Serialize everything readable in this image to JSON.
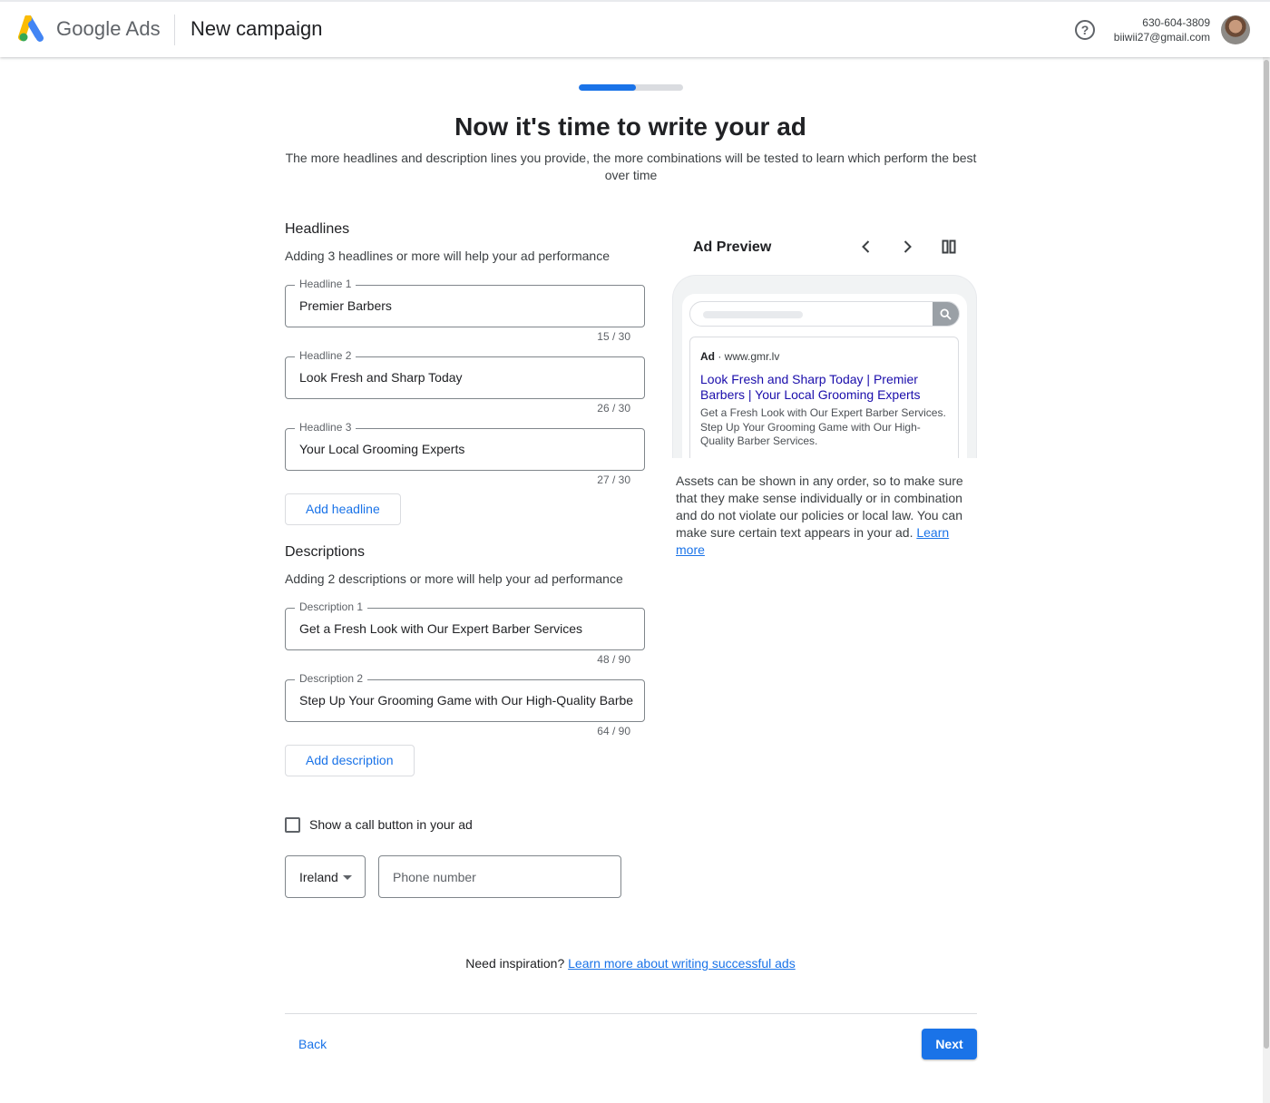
{
  "header": {
    "brand": "Google Ads",
    "campaign_title": "New campaign",
    "account_phone": "630-604-3809",
    "account_email": "biiwii27@gmail.com",
    "help_icon": "help-circle-icon",
    "help_glyph": "?"
  },
  "progress": {
    "fraction": 0.55
  },
  "page": {
    "title": "Now it's time to write your ad",
    "subtitle": "The more headlines and description lines you provide, the more combinations will be tested to learn which perform the best over time"
  },
  "headlines": {
    "title": "Headlines",
    "help": "Adding 3 headlines or more will help your ad performance",
    "items": [
      {
        "label": "Headline 1",
        "value": "Premier Barbers",
        "counter": "15 / 30"
      },
      {
        "label": "Headline 2",
        "value": "Look Fresh and Sharp Today",
        "counter": "26 / 30"
      },
      {
        "label": "Headline 3",
        "value": "Your Local Grooming Experts",
        "counter": "27 / 30"
      }
    ],
    "add_label": "Add headline"
  },
  "descriptions": {
    "title": "Descriptions",
    "help": "Adding 2 descriptions or more will help your ad performance",
    "items": [
      {
        "label": "Description 1",
        "value": "Get a Fresh Look with Our Expert Barber Services",
        "counter": "48 / 90"
      },
      {
        "label": "Description 2",
        "value": "Step Up Your Grooming Game with Our High-Quality Barber Se",
        "counter": "64 / 90"
      }
    ],
    "add_label": "Add description"
  },
  "call": {
    "checkbox_label": "Show a call button in your ad",
    "checked": false,
    "country": "Ireland",
    "phone_placeholder": "Phone number"
  },
  "inspiration": {
    "prefix": "Need inspiration?",
    "link": "Learn more about writing successful ads"
  },
  "footer": {
    "back_label": "Back",
    "next_label": "Next"
  },
  "preview": {
    "title": "Ad Preview",
    "ad_label": "Ad",
    "ad_url": "· www.gmr.lv",
    "headline": "Look Fresh and Sharp Today | Premier Barbers | Your Local Grooming Experts",
    "description": "Get a Fresh Look with Our Expert Barber Services. Step Up Your Grooming Game with Our High-Quality Barber Services.",
    "note": "Assets can be shown in any order, so to make sure that they make sense individually or in combination and do not violate our policies or local law. You can make sure certain text appears in your ad.",
    "note_link": "Learn more"
  },
  "colors": {
    "accent": "#1a73e8",
    "ad_headline": "#1a0dab"
  }
}
